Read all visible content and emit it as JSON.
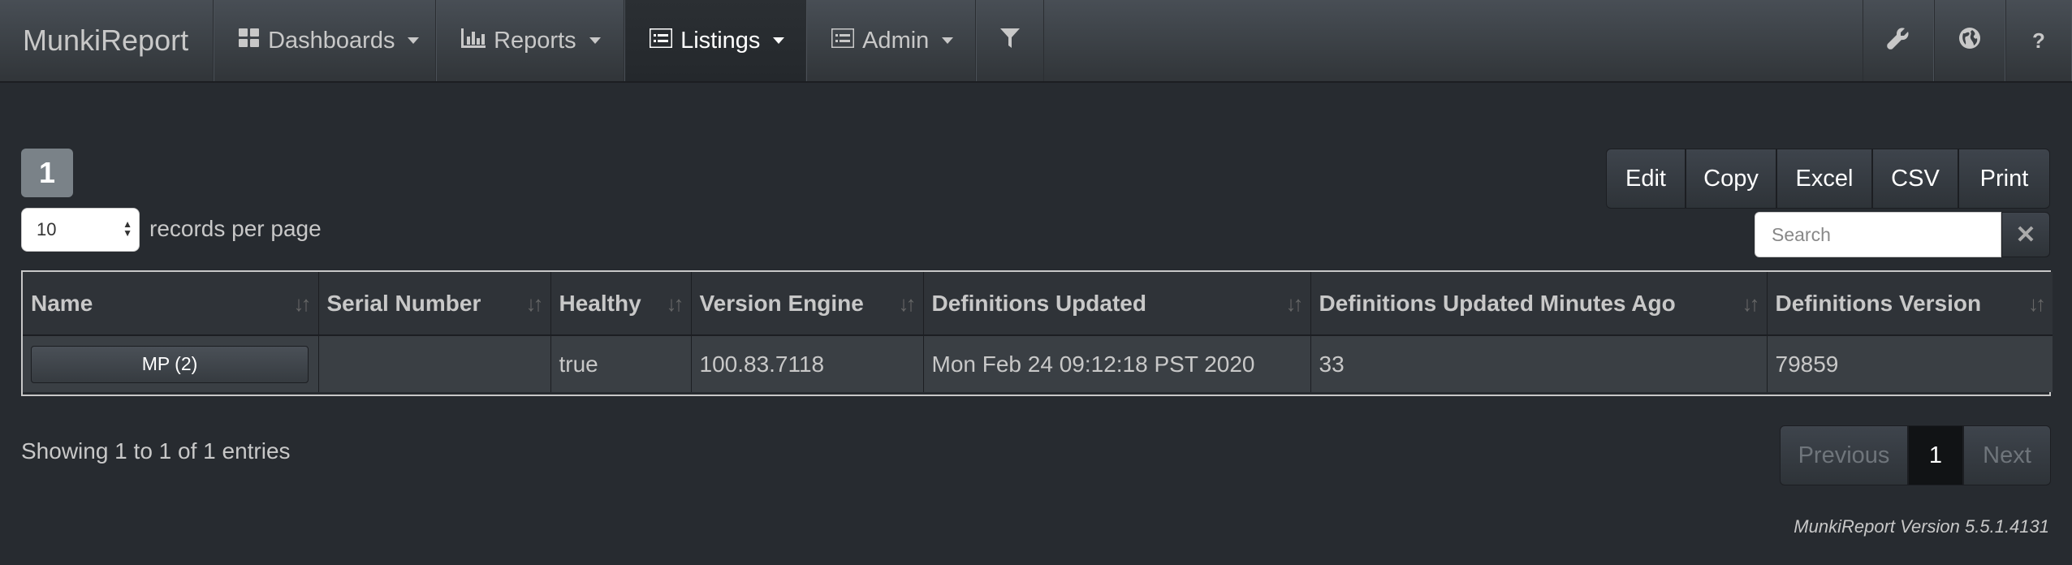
{
  "navbar": {
    "brand": "MunkiReport",
    "items": [
      {
        "label": "Dashboards"
      },
      {
        "label": "Reports"
      },
      {
        "label": "Listings"
      },
      {
        "label": "Admin"
      }
    ]
  },
  "table_controls": {
    "page_badge": "1",
    "records_per_page_value": "10",
    "records_per_page_label": "records per page",
    "buttons": [
      "Edit",
      "Copy",
      "Excel",
      "CSV",
      "Print"
    ],
    "search_placeholder": "Search"
  },
  "table": {
    "columns": [
      "Name",
      "Serial Number",
      "Healthy",
      "Version Engine",
      "Definitions Updated",
      "Definitions Updated Minutes Ago",
      "Definitions Version"
    ],
    "rows": [
      [
        "MP (2)",
        "",
        "true",
        "100.83.7118",
        "Mon Feb 24 09:12:18 PST 2020",
        "33",
        "79859"
      ]
    ]
  },
  "footer": {
    "info": "Showing 1 to 1 of 1 entries",
    "pager": {
      "previous": "Previous",
      "current": "1",
      "next": "Next"
    },
    "version": "MunkiReport Version 5.5.1.4131"
  }
}
